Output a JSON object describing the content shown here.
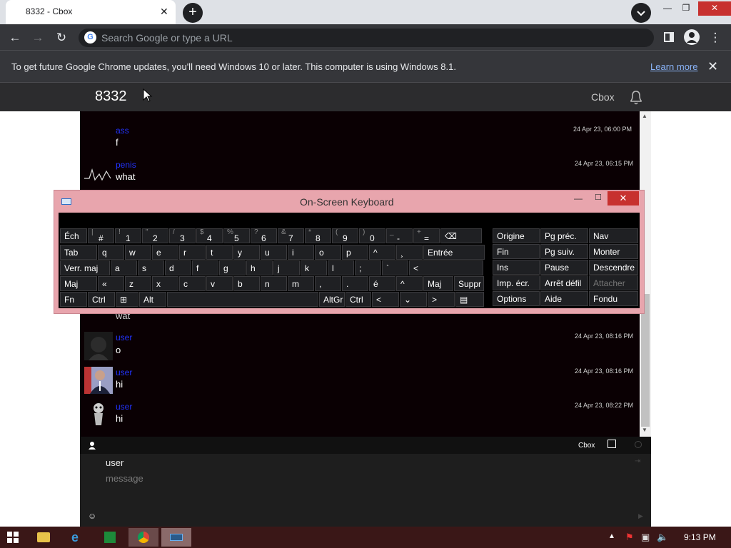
{
  "browser": {
    "tab_title": "8332 - Cbox",
    "tab_close": "✕",
    "new_tab": "+",
    "omnibox_placeholder": "Search Google or type a URL",
    "infobar_text": "To get future Google Chrome updates, you'll need Windows 10 or later. This computer is using Windows 8.1.",
    "infobar_link": "Learn more",
    "infobar_close": "✕"
  },
  "site": {
    "title": "8332",
    "brand": "Cbox"
  },
  "chat": {
    "messages": [
      {
        "user": "ass",
        "text": "f",
        "time": "24 Apr 23, 06:00 PM"
      },
      {
        "user": "penis",
        "text": "what",
        "time": "24 Apr 23, 06:15 PM"
      },
      {
        "user": "",
        "text": "wat",
        "time": ""
      },
      {
        "user": "user",
        "text": "o",
        "time": "24 Apr 23, 08:16 PM"
      },
      {
        "user": "user",
        "text": "hi",
        "time": "24 Apr 23, 08:16 PM"
      },
      {
        "user": "user",
        "text": "hi",
        "time": "24 Apr 23, 08:22 PM"
      }
    ],
    "footer_brand": "Cbox",
    "input_user": "user",
    "input_placeholder": "message"
  },
  "osk": {
    "title": "On-Screen Keyboard",
    "row1": [
      {
        "main": "Éch"
      },
      {
        "shift": "|",
        "main": "#"
      },
      {
        "shift": "!",
        "main": "1"
      },
      {
        "shift": "\"",
        "main": "2"
      },
      {
        "shift": "/",
        "main": "3"
      },
      {
        "shift": "$",
        "main": "4"
      },
      {
        "shift": "%",
        "main": "5"
      },
      {
        "shift": "?",
        "main": "6"
      },
      {
        "shift": "&",
        "main": "7"
      },
      {
        "shift": "*",
        "main": "8"
      },
      {
        "shift": "(",
        "main": "9"
      },
      {
        "shift": ")",
        "main": "0"
      },
      {
        "shift": "_",
        "main": "-"
      },
      {
        "shift": "+",
        "main": "="
      },
      {
        "main": "⌫"
      }
    ],
    "row2": [
      "Tab",
      "q",
      "w",
      "e",
      "r",
      "t",
      "y",
      "u",
      "i",
      "o",
      "p",
      "^",
      "¸",
      "Entrée"
    ],
    "row3": [
      "Verr. maj",
      "a",
      "s",
      "d",
      "f",
      "g",
      "h",
      "j",
      "k",
      "l",
      ";",
      "`",
      "<"
    ],
    "row4": [
      "Maj",
      "«",
      "z",
      "x",
      "c",
      "v",
      "b",
      "n",
      "m",
      ",",
      ".",
      "é",
      "^",
      "Maj",
      "Suppr"
    ],
    "row5": [
      "Fn",
      "Ctrl",
      "⊞",
      "Alt",
      "",
      "AltGr",
      "Ctrl",
      "<",
      "⌄",
      ">",
      "▤"
    ],
    "nav": [
      [
        "Origine",
        "Pg préc.",
        "Nav"
      ],
      [
        "Fin",
        "Pg suiv.",
        "Monter"
      ],
      [
        "Ins",
        "Pause",
        "Descendre"
      ],
      [
        "Imp. écr.",
        "Arrêt défil",
        "Attacher"
      ],
      [
        "Options",
        "Aide",
        "Fondu"
      ]
    ]
  },
  "taskbar": {
    "clock": "9:13 PM"
  }
}
